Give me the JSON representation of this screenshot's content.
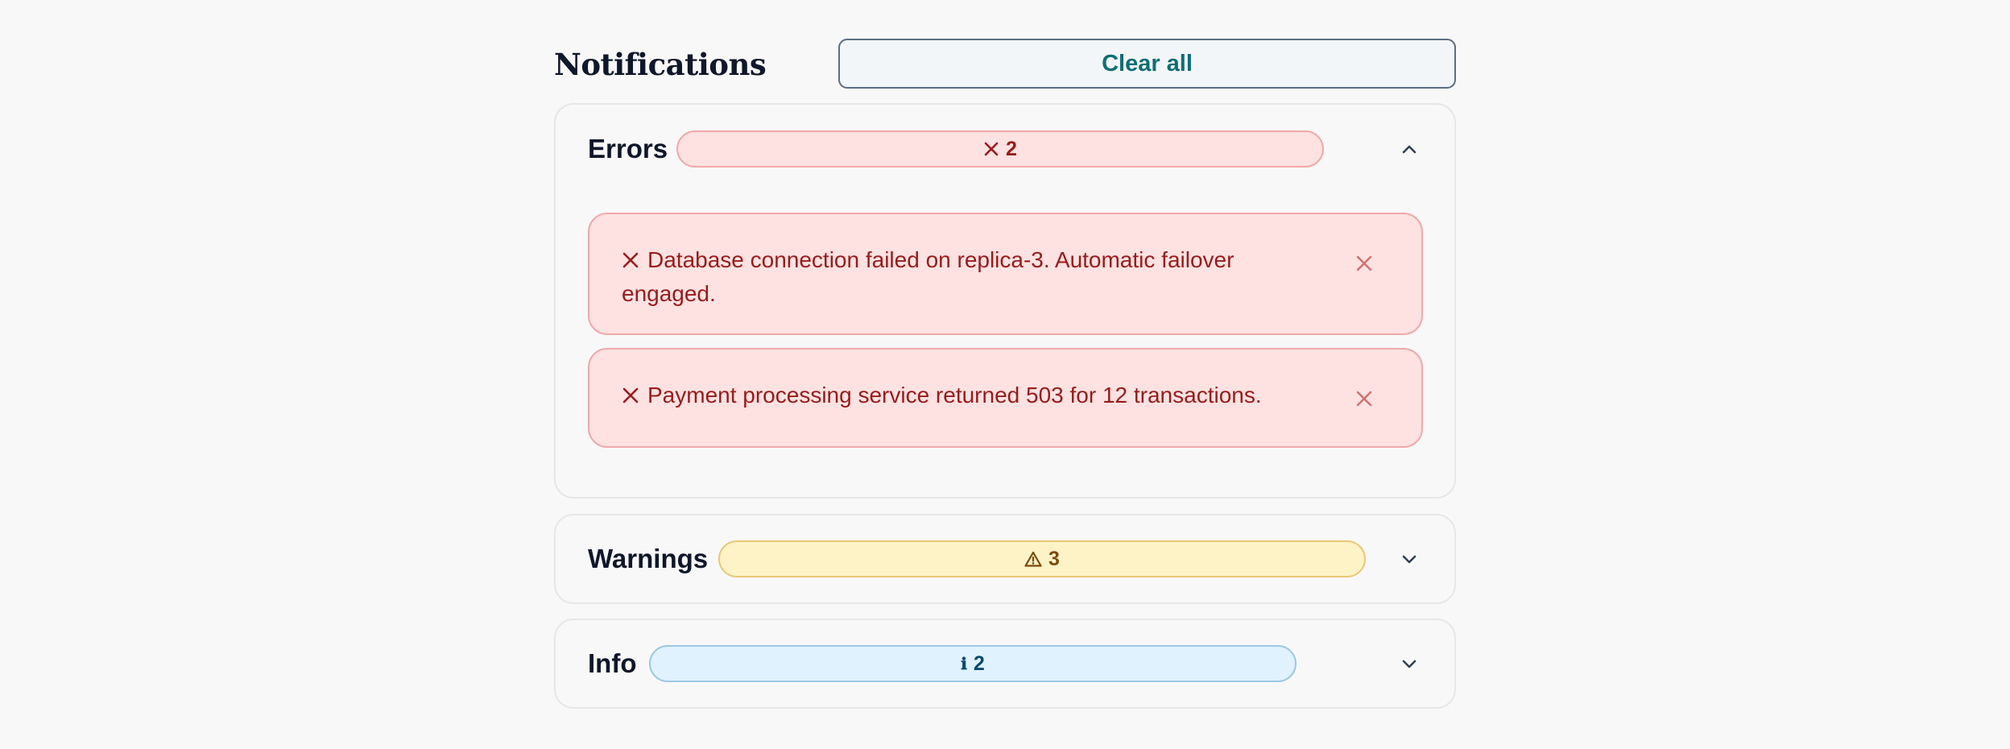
{
  "header": {
    "title": "Notifications",
    "clear_all_label": "Clear all"
  },
  "colors": {
    "error_text": "#991b1b",
    "error_bg": "#fee2e2",
    "warning_bg": "#fef3c7",
    "info_bg": "#e0f2fe",
    "accent": "#0f6e75"
  },
  "sections": {
    "errors": {
      "title": "Errors",
      "count": "2",
      "icon": "x-icon",
      "expanded": true,
      "messages": [
        {
          "text": "Database connection failed on replica-3. Automatic failover engaged."
        },
        {
          "text": "Payment processing service returned 503 for 12 transactions."
        }
      ]
    },
    "warnings": {
      "title": "Warnings",
      "count": "3",
      "icon": "warning-triangle-icon",
      "expanded": false
    },
    "info": {
      "title": "Info",
      "count": "2",
      "icon": "info-icon",
      "expanded": false
    }
  }
}
